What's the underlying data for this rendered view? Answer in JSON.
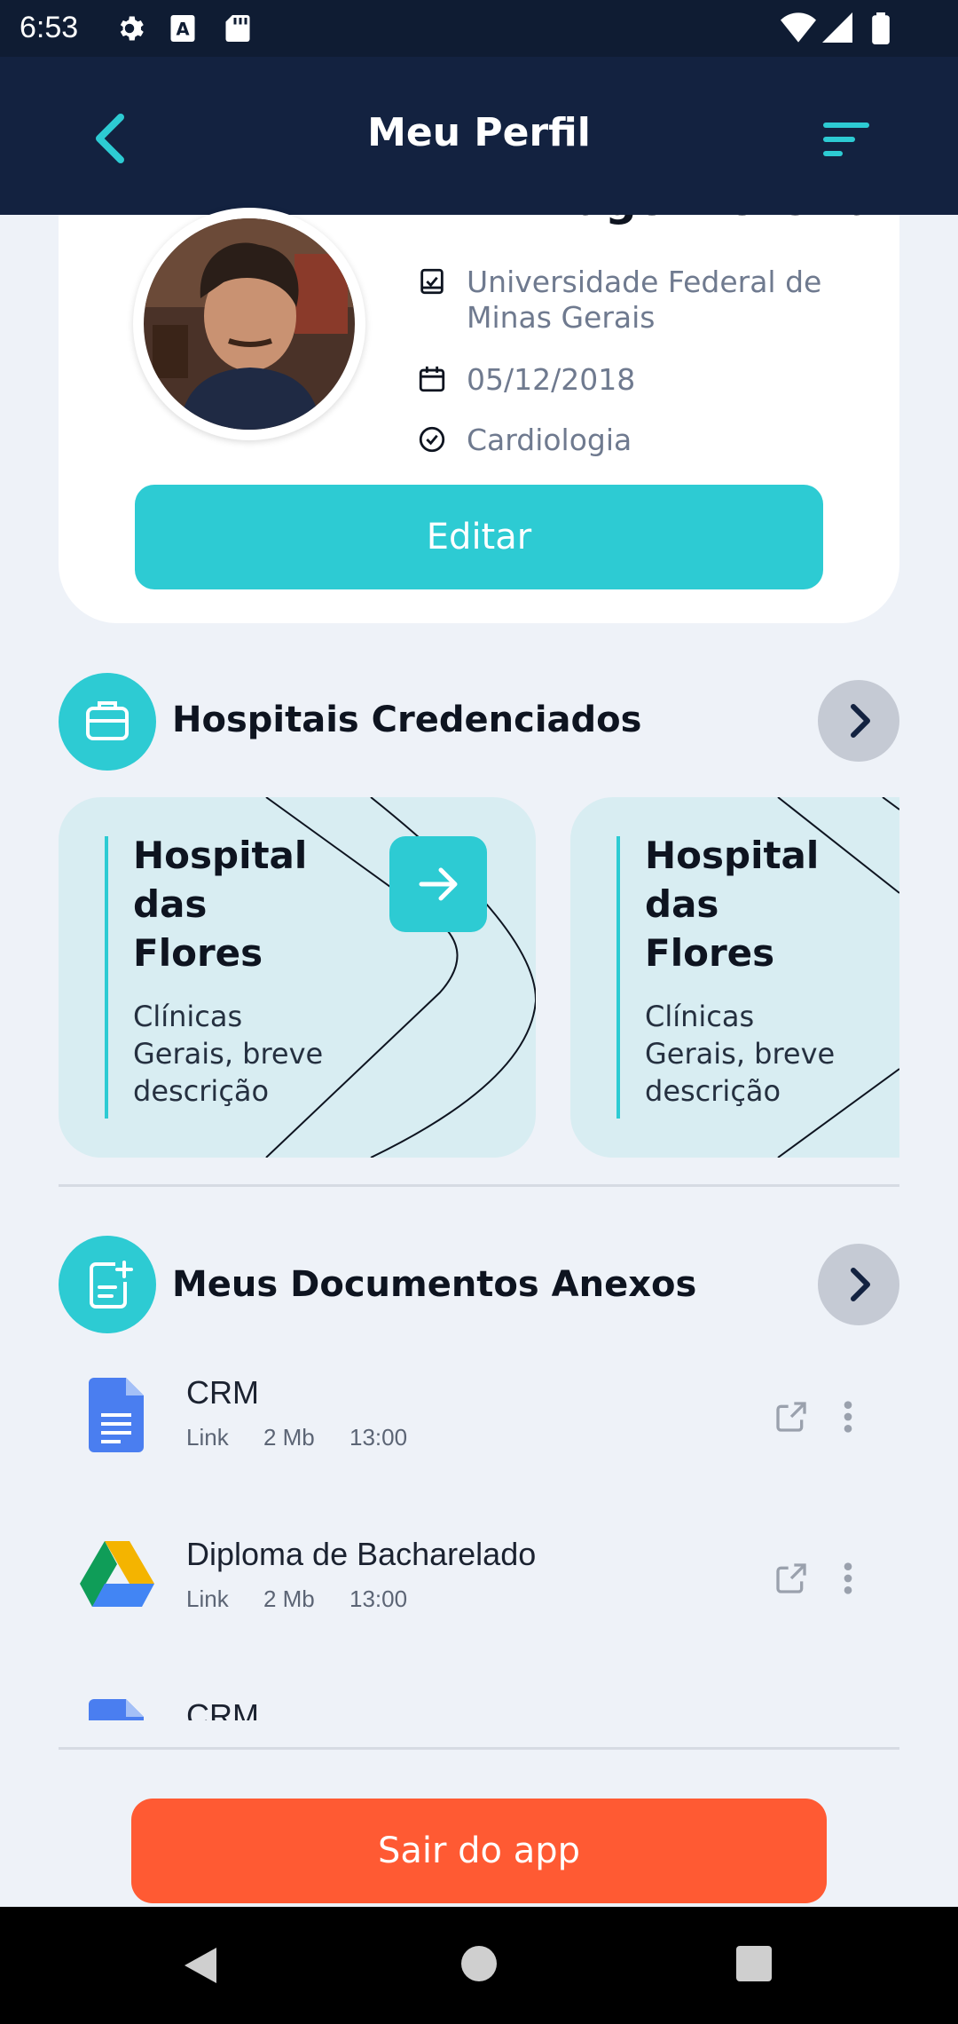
{
  "status_bar": {
    "time": "6:53"
  },
  "header": {
    "title": "Meu Perfil"
  },
  "profile": {
    "name": "Dr. Thiago Moreira",
    "university": "Universidade Federal de Minas Gerais",
    "date": "05/12/2018",
    "specialty": "Cardiologia",
    "edit_label": "Editar"
  },
  "hospitals": {
    "title": "Hospitais Credenciados",
    "items": [
      {
        "name": "Hospital das Flores",
        "description": "Clínicas Gerais, breve descrição"
      },
      {
        "name": "Hospital das Flores",
        "description": "Clínicas Gerais, breve descrição"
      }
    ]
  },
  "documents": {
    "title": "Meus Documentos Anexos",
    "items": [
      {
        "name": "CRM",
        "type": "Link",
        "size": "2 Mb",
        "time": "13:00",
        "icon": "google-docs-icon"
      },
      {
        "name": "Diploma de Bacharelado",
        "type": "Link",
        "size": "2 Mb",
        "time": "13:00",
        "icon": "google-drive-icon"
      },
      {
        "name": "CRM",
        "icon": "google-docs-icon"
      }
    ]
  },
  "logout_label": "Sair do app",
  "colors": {
    "accent": "#2dcbd3",
    "header": "#132240",
    "danger": "#ff5a33"
  }
}
